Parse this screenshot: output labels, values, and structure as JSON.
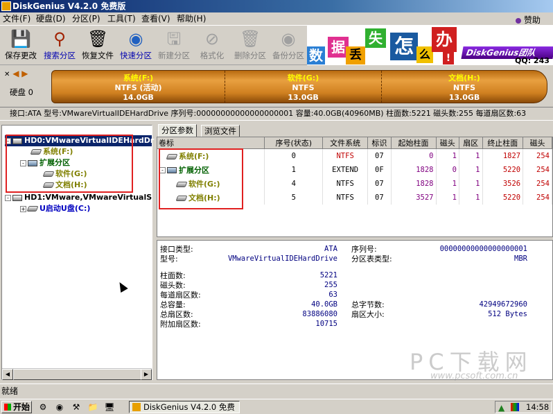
{
  "window": {
    "title": "DiskGenius V4.2.0 免费版"
  },
  "menu": {
    "items": [
      "文件(F)",
      "硬盘(D)",
      "分区(P)",
      "工具(T)",
      "查看(V)",
      "帮助(H)"
    ],
    "donate": "赞助"
  },
  "toolbar": {
    "buttons": [
      {
        "label": "保存更改",
        "icon": "save-icon"
      },
      {
        "label": "搜索分区",
        "icon": "search-icon"
      },
      {
        "label": "恢复文件",
        "icon": "recover-icon"
      },
      {
        "label": "快速分区",
        "icon": "quick-partition-icon"
      },
      {
        "label": "新建分区",
        "icon": "new-partition-icon"
      },
      {
        "label": "格式化",
        "icon": "format-icon"
      },
      {
        "label": "删除分区",
        "icon": "delete-icon"
      },
      {
        "label": "备份分区",
        "icon": "backup-icon"
      }
    ]
  },
  "banner": {
    "chars": [
      "数",
      "据",
      "丢",
      "失",
      "怎",
      "么",
      "办",
      "!"
    ],
    "brand": "DiskGenius团队",
    "qq": "QQ: 243"
  },
  "diskbar": {
    "disk_label": "硬盘 0",
    "partitions": [
      {
        "name": "系统(F:)",
        "fs": "NTFS (活动)",
        "size": "14.0GB"
      },
      {
        "name": "软件(G:)",
        "fs": "NTFS",
        "size": "13.0GB"
      },
      {
        "name": "文档(H:)",
        "fs": "NTFS",
        "size": "13.0GB"
      }
    ]
  },
  "infobar": {
    "text": "接口:ATA  型号:VMwareVirtualIDEHardDrive  序列号:00000000000000000001  容量:40.0GB(40960MB)  柱面数:5221  磁头数:255  每道扇区数:63"
  },
  "tree": {
    "hd0": "HD0:VMwareVirtualIDEHardDr",
    "sys": "系统(F:)",
    "ext": "扩展分区",
    "soft": "软件(G:)",
    "doc": "文档(H:)",
    "hd1": "HD1:VMware,VMwareVirtualS",
    "usb": "U启动U盘(C:)"
  },
  "tabs": [
    "分区参数",
    "浏览文件"
  ],
  "table": {
    "headers": [
      "卷标",
      "序号(状态)",
      "文件系统",
      "标识",
      "起始柱面",
      "磁头",
      "扇区",
      "终止柱面",
      "磁头"
    ],
    "rows": [
      {
        "name": "系统(F:)",
        "seq": "0",
        "fs": "NTFS",
        "id": "07",
        "start_cyl": "0",
        "head": "1",
        "sector": "1",
        "end_cyl": "1827",
        "end_head": "254"
      },
      {
        "name": "扩展分区",
        "seq": "1",
        "fs": "EXTEND",
        "id": "0F",
        "start_cyl": "1828",
        "head": "0",
        "sector": "1",
        "end_cyl": "5220",
        "end_head": "254"
      },
      {
        "name": "软件(G:)",
        "seq": "4",
        "fs": "NTFS",
        "id": "07",
        "start_cyl": "1828",
        "head": "1",
        "sector": "1",
        "end_cyl": "3526",
        "end_head": "254"
      },
      {
        "name": "文档(H:)",
        "seq": "5",
        "fs": "NTFS",
        "id": "07",
        "start_cyl": "3527",
        "head": "1",
        "sector": "1",
        "end_cyl": "5220",
        "end_head": "254"
      }
    ]
  },
  "details": {
    "iface_label": "接口类型:",
    "iface": "ATA",
    "model_label": "型号:",
    "model": "VMwareVirtualIDEHardDrive",
    "serial_label": "序列号:",
    "serial": "00000000000000000001",
    "pt_label": "分区表类型:",
    "pt": "MBR",
    "cyl_label": "柱面数:",
    "cyl": "5221",
    "heads_label": "磁头数:",
    "heads": "255",
    "spt_label": "每道扇区数:",
    "spt": "63",
    "cap_label": "总容量:",
    "cap": "40.0GB",
    "bytes_label": "总字节数:",
    "bytes": "42949672960",
    "sectors_label": "总扇区数:",
    "sectors": "83886080",
    "secsize_label": "扇区大小:",
    "secsize": "512 Bytes",
    "extra_label": "附加扇区数:",
    "extra": "10715"
  },
  "status": {
    "text": "就绪"
  },
  "taskbar": {
    "start": "开始",
    "task": "DiskGenius V4.2.0 免费版",
    "time": "14:58"
  },
  "watermark": {
    "main": "PC下载网",
    "url": "www.pcsoft.com.cn"
  }
}
